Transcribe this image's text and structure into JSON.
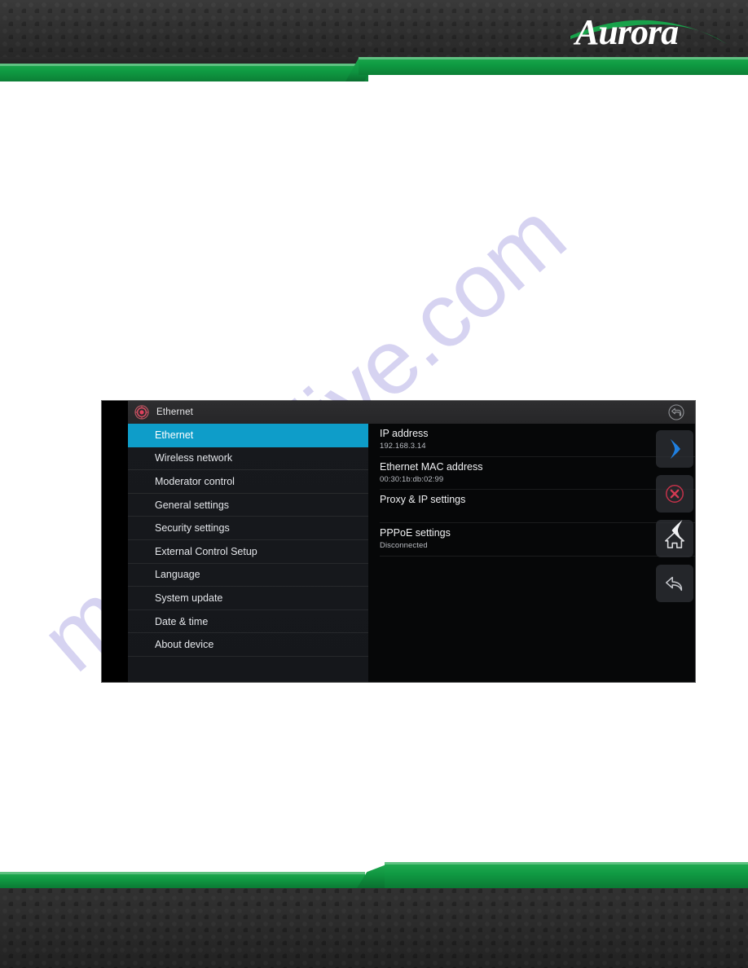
{
  "brand": {
    "logo_text": "Aurora",
    "accent_green": "#0f9c43",
    "header_dark": "#303030"
  },
  "watermark": {
    "text": "manualslive.com",
    "color": "#786ED2"
  },
  "device": {
    "titlebar": {
      "title": "Ethernet",
      "left_icon": "settings-gear-icon",
      "right_icon": "return-arrow-circle-icon"
    },
    "sidebar": {
      "items": [
        {
          "label": "Ethernet",
          "active": true
        },
        {
          "label": "Wireless network",
          "active": false
        },
        {
          "label": "Moderator control",
          "active": false
        },
        {
          "label": "General settings",
          "active": false
        },
        {
          "label": "Security settings",
          "active": false
        },
        {
          "label": "External Control Setup",
          "active": false
        },
        {
          "label": "Language",
          "active": false
        },
        {
          "label": "System update",
          "active": false
        },
        {
          "label": "Date & time",
          "active": false
        },
        {
          "label": "About device",
          "active": false
        }
      ],
      "active_color": "#0e9dc9"
    },
    "content": {
      "rows": [
        {
          "title": "IP address",
          "value": "192.168.3.14"
        },
        {
          "title": "Ethernet MAC address",
          "value": "00:30:1b:db:02:99"
        },
        {
          "title": "Proxy & IP settings",
          "value": ""
        },
        {
          "title": "PPPoE settings",
          "value": "Disconnected"
        }
      ]
    },
    "overlay_buttons": [
      {
        "name": "chevron-right-icon",
        "color": "#1f7fe0"
      },
      {
        "name": "close-circle-icon",
        "color": "#c4324a"
      },
      {
        "name": "back-chevron-icon",
        "color": "#dcdde0"
      },
      {
        "name": "home-icon",
        "color": "#dcdde0"
      },
      {
        "name": "undo-arrow-icon",
        "color": "#c8cacf"
      }
    ]
  }
}
